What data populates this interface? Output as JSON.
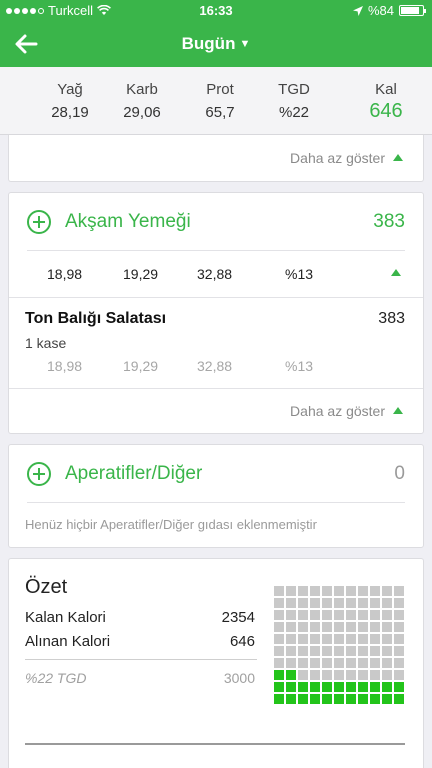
{
  "status": {
    "carrier": "Turkcell",
    "time": "16:33",
    "battery": "%84",
    "battery_level": 0.84
  },
  "nav": {
    "title": "Bugün"
  },
  "summary": [
    {
      "label": "Yağ",
      "value": "28,19"
    },
    {
      "label": "Karb",
      "value": "29,06"
    },
    {
      "label": "Prot",
      "value": "65,7"
    },
    {
      "label": "TGD",
      "value": "%22"
    },
    {
      "label": "Kal",
      "value": "646"
    }
  ],
  "top_card": {
    "less_label": "Daha az göster"
  },
  "dinner": {
    "title": "Akşam Yemeği",
    "calories": "383",
    "totals": [
      "18,98",
      "19,29",
      "32,88",
      "%13"
    ],
    "item": {
      "name": "Ton Balığı Salatası",
      "calories": "383",
      "portion": "1 kase",
      "macros": [
        "18,98",
        "19,29",
        "32,88",
        "%13"
      ]
    },
    "less_label": "Daha az göster"
  },
  "snacks": {
    "title": "Aperatifler/Diğer",
    "calories": "0",
    "empty_text": "Henüz hiçbir Aperatifler/Diğer gıdası eklenmemiştir"
  },
  "overview": {
    "title": "Özet",
    "rows": [
      {
        "label": "Kalan Kalori",
        "value": "2354"
      },
      {
        "label": "Alınan Kalori",
        "value": "646"
      }
    ],
    "target": {
      "label": "%22 TGD",
      "value": "3000"
    },
    "grid_total": 110,
    "grid_filled": 24,
    "colors": {
      "filled": "#23c41a",
      "empty": "#c9c9c9",
      "accent": "#3ab54a"
    }
  }
}
